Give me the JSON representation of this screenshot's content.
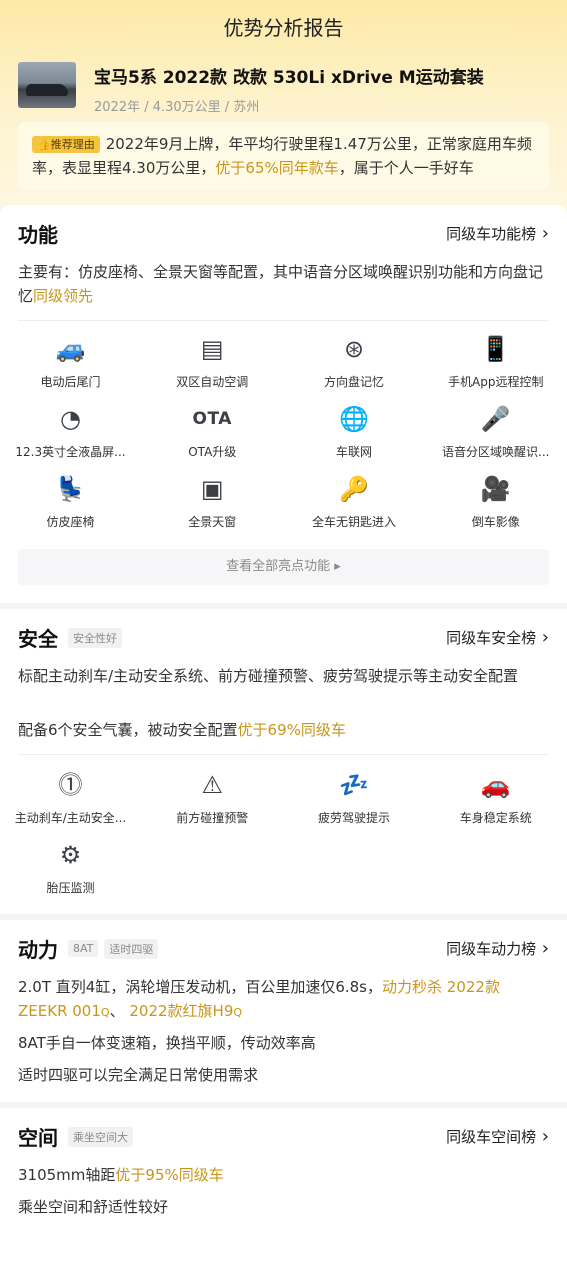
{
  "page_title": "优势分析报告",
  "car": {
    "name": "宝马5系 2022款 改款 530Li xDrive M运动套装",
    "meta": "2022年 / 4.30万公里 / 苏州"
  },
  "reason": {
    "tag": "推荐理由",
    "text_before": "2022年9月上牌，年平均行驶里程1.47万公里，正常家庭用车频率，表显里程4.30万公里，",
    "highlight": "优于65%同年款车",
    "text_after": "，属于个人一手好车"
  },
  "function": {
    "title": "功能",
    "rank": "同级车功能榜",
    "desc_before": "主要有：仿皮座椅、全景天窗等配置，其中语音分区域唤醒识别功能和方向盘记忆",
    "desc_highlight": "同级领先",
    "features": [
      {
        "icon": "trunk-icon",
        "glyph": "🚙",
        "label": "电动后尾门"
      },
      {
        "icon": "ac-icon",
        "glyph": "▤",
        "label": "双区自动空调"
      },
      {
        "icon": "steering-wheel-icon",
        "glyph": "⊛",
        "label": "方向盘记忆"
      },
      {
        "icon": "phone-car-icon",
        "glyph": "📱",
        "label": "手机App远程控制"
      },
      {
        "icon": "lcd-icon",
        "glyph": "◔",
        "label": "12.3英寸全液晶屏..."
      },
      {
        "icon": "ota-icon",
        "glyph": "OTA",
        "label": "OTA升级"
      },
      {
        "icon": "globe-icon",
        "glyph": "🌐",
        "label": "车联网"
      },
      {
        "icon": "microphone-icon",
        "glyph": "🎤",
        "label": "语音分区域唤醒识..."
      },
      {
        "icon": "seat-icon",
        "glyph": "💺",
        "label": "仿皮座椅"
      },
      {
        "icon": "sunroof-icon",
        "glyph": "▣",
        "label": "全景天窗"
      },
      {
        "icon": "keyless-icon",
        "glyph": "🔑",
        "label": "全车无钥匙进入"
      },
      {
        "icon": "reverse-camera-icon",
        "glyph": "🎥",
        "label": "倒车影像"
      }
    ],
    "more_label": "查看全部亮点功能 ▸"
  },
  "safety": {
    "title": "安全",
    "tag": "安全性好",
    "rank": "同级车安全榜",
    "desc1": "标配主动刹车/主动安全系统、前方碰撞预警、疲劳驾驶提示等主动安全配置",
    "desc2_before": "配备6个安全气囊，被动安全配置",
    "desc2_highlight": "优于69%同级车",
    "features": [
      {
        "icon": "brake-icon",
        "glyph": "⓵",
        "label": "主动刹车/主动安全..."
      },
      {
        "icon": "collision-warning-icon",
        "glyph": "⚠",
        "label": "前方碰撞预警"
      },
      {
        "icon": "fatigue-icon",
        "glyph": "💤",
        "label": "疲劳驾驶提示"
      },
      {
        "icon": "stability-icon",
        "glyph": "🚗",
        "label": "车身稳定系统"
      },
      {
        "icon": "tire-pressure-icon",
        "glyph": "⚙",
        "label": "胎压监测"
      }
    ]
  },
  "power": {
    "title": "动力",
    "tag1": "8AT",
    "tag2": "适时四驱",
    "rank": "同级车动力榜",
    "desc1_before": "2.0T 直列4缸，涡轮增压发动机，百公里加速仅6.8s，",
    "desc1_highlight": "动力秒杀 2022款ZEEKR 001",
    "desc1_sep": "、",
    "desc1_highlight2": "2022款红旗H9",
    "desc2": "8AT手自一体变速箱，换挡平顺，传动效率高",
    "desc3": "适时四驱可以完全满足日常使用需求"
  },
  "space": {
    "title": "空间",
    "tag": "乘坐空间大",
    "rank": "同级车空间榜",
    "desc1_before": "3105mm轴距",
    "desc1_highlight": "优于95%同级车",
    "desc2": "乘坐空间和舒适性较好"
  }
}
